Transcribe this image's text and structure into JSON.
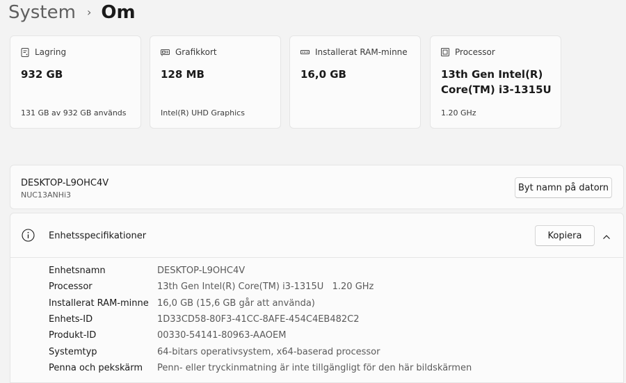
{
  "breadcrumb": {
    "parent": "System",
    "separator": "›",
    "current": "Om"
  },
  "cards": [
    {
      "icon": "storage-icon",
      "label": "Lagring",
      "value": "932 GB",
      "sub": "131 GB av 932 GB används"
    },
    {
      "icon": "graphics-card-icon",
      "label": "Grafikkort",
      "value": "128 MB",
      "sub": "Intel(R) UHD Graphics"
    },
    {
      "icon": "ram-icon",
      "label": "Installerat RAM-minne",
      "value": "16,0 GB",
      "sub": ""
    },
    {
      "icon": "processor-icon",
      "label": "Processor",
      "value": "13th Gen Intel(R) Core(TM) i3-1315U",
      "sub": "1.20 GHz"
    }
  ],
  "device": {
    "name": "DESKTOP-L9OHC4V",
    "model": "NUC13ANHi3",
    "rename_label": "Byt namn på datorn"
  },
  "specs": {
    "title": "Enhetsspecifikationer",
    "copy_label": "Kopiera",
    "rows": [
      {
        "label": "Enhetsnamn",
        "value": "DESKTOP-L9OHC4V"
      },
      {
        "label": "Processor",
        "value": "13th Gen Intel(R) Core(TM) i3-1315U   1.20 GHz"
      },
      {
        "label": "Installerat RAM-minne",
        "value": "16,0 GB (15,6 GB går att använda)"
      },
      {
        "label": "Enhets-ID",
        "value": "1D33CD58-80F3-41CC-8AFE-454C4EB482C2"
      },
      {
        "label": "Produkt-ID",
        "value": "00330-54141-80963-AAOEM"
      },
      {
        "label": "Systemtyp",
        "value": "64-bitars operativsystem, x64-baserad processor"
      },
      {
        "label": "Penna och pekskärm",
        "value": "Penn- eller tryckinmatning är inte tillgängligt för den här bildskärmen"
      }
    ]
  }
}
